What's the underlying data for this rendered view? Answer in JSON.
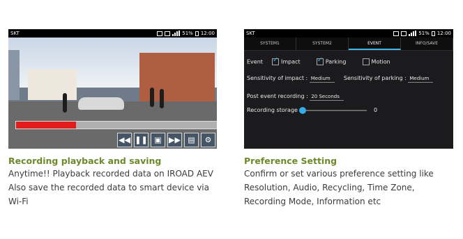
{
  "left": {
    "status": {
      "carrier": "SKT",
      "battery": "51%",
      "time": "12:00"
    },
    "title": "Recording playback and saving",
    "lines": [
      "Anytime!! Playback recorded data on IROAD AEV",
      "Also save the recorded data to smart device via",
      "Wi-Fi"
    ],
    "progress_fraction": 0.3,
    "controls": [
      "rewind",
      "pause",
      "fullscreen",
      "forward",
      "save",
      "settings"
    ]
  },
  "right": {
    "status": {
      "carrier": "SKT",
      "battery": "51%",
      "time": "12:00"
    },
    "tabs": [
      "SYSTEM1",
      "SYSTEM2",
      "EVENT",
      "INFO/SAVE"
    ],
    "active_tab_index": 2,
    "event_label": "Event",
    "checkboxes": [
      {
        "label": "Impact",
        "checked": true
      },
      {
        "label": "Parking",
        "checked": true
      },
      {
        "label": "Motion",
        "checked": false
      }
    ],
    "sensitivity_impact_label": "Sensitivity of impact :",
    "sensitivity_impact_value": "Medium",
    "sensitivity_parking_label": "Sensitivity of parking :",
    "sensitivity_parking_value": "Medium",
    "post_event_label": "Post event recording :",
    "post_event_value": "20 Seconds",
    "storage_label": "Recording storage :",
    "storage_value": "0",
    "title": "Preference Setting",
    "lines": [
      "Confirm or set various preference setting like",
      "Resolution, Audio, Recycling, Time Zone,",
      "Recording Mode, Information etc"
    ]
  }
}
